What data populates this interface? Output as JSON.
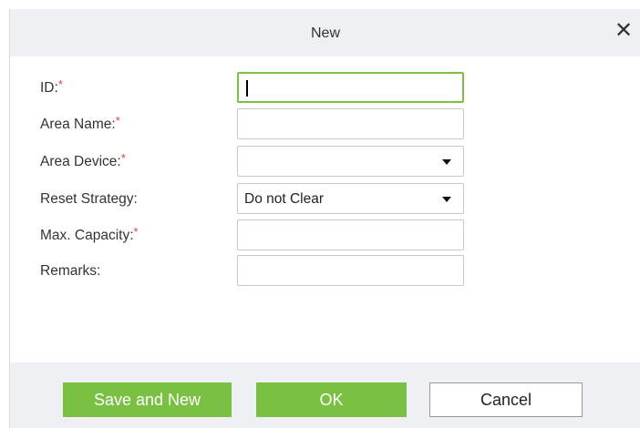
{
  "dialog": {
    "title": "New",
    "close_glyph": "✕"
  },
  "form": {
    "required_mark": "*",
    "fields": [
      {
        "label": "ID:",
        "required": true,
        "type": "text",
        "value": ""
      },
      {
        "label": "Area Name:",
        "required": true,
        "type": "text",
        "value": ""
      },
      {
        "label": "Area Device:",
        "required": true,
        "type": "select",
        "value": ""
      },
      {
        "label": "Reset Strategy:",
        "required": false,
        "type": "select",
        "value": "Do not Clear"
      },
      {
        "label": "Max. Capacity:",
        "required": true,
        "type": "text",
        "value": ""
      },
      {
        "label": "Remarks:",
        "required": false,
        "type": "text",
        "value": ""
      }
    ]
  },
  "buttons": {
    "save_and_new": "Save and New",
    "ok": "OK",
    "cancel": "Cancel"
  },
  "colors": {
    "accent": "#7ac143",
    "required": "#e54242",
    "header_bg": "#eef0f4"
  },
  "icons": {
    "close": "close-icon",
    "dropdown": "chevron-down-icon"
  }
}
